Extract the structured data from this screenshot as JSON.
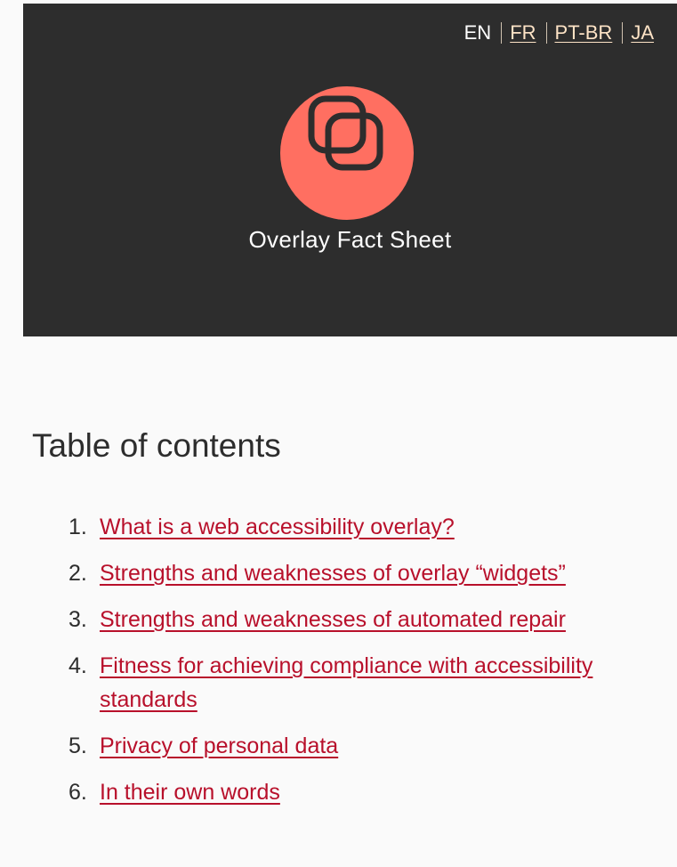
{
  "header": {
    "languages": {
      "current": "EN",
      "links": [
        "FR",
        "PT-BR",
        "JA"
      ]
    },
    "title": "Overlay Fact Sheet",
    "colors": {
      "background": "#2d2d2d",
      "logo_circle": "#ff6f61",
      "lang_link": "#fde3c6"
    },
    "logo_icon": "overlapping-squares-icon"
  },
  "toc": {
    "heading": "Table of contents",
    "link_color": "#b8102b",
    "items": [
      {
        "number": "1.",
        "label": "What is a web accessibility overlay?"
      },
      {
        "number": "2.",
        "label": "Strengths and weaknesses of overlay “widgets”"
      },
      {
        "number": "3.",
        "label": "Strengths and weaknesses of automated repair"
      },
      {
        "number": "4.",
        "label": "Fitness for achieving compliance with accessibility standards"
      },
      {
        "number": "5.",
        "label": "Privacy of personal data"
      },
      {
        "number": "6.",
        "label": "In their own words"
      }
    ]
  }
}
